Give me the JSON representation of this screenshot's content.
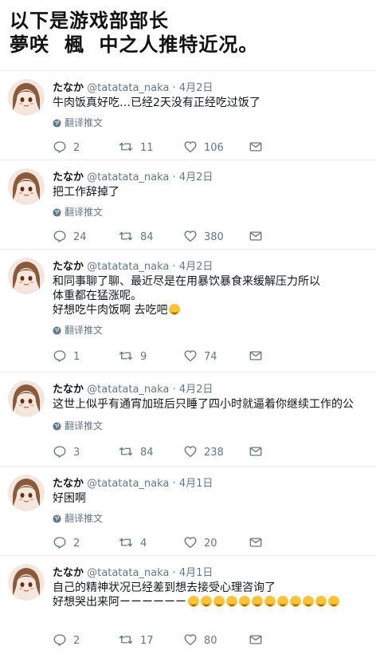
{
  "header": {
    "line1": "以下是游戏部部长",
    "line2": "夢咲  楓  中之人推特近况。"
  },
  "colors": {
    "muted": "#657786",
    "text": "#14171a",
    "border": "#e6ecf0"
  },
  "icons": {
    "reply": "reply-icon",
    "retweet": "retweet-icon",
    "like": "heart-icon",
    "dm": "mail-icon",
    "translate": "globe-icon"
  },
  "tweets": [
    {
      "name": "たなか",
      "handle": "@tatatata_naka",
      "sep": "·",
      "date": "4月2日",
      "lines": [
        "牛肉饭真好吃…已经2天没有正经吃过饭了"
      ],
      "translate": "翻译推文",
      "replies": "2",
      "retweets": "11",
      "likes": "106"
    },
    {
      "name": "たなか",
      "handle": "@tatatata_naka",
      "sep": "·",
      "date": "4月2日",
      "lines": [
        "把工作辞掉了"
      ],
      "translate": "翻译推文",
      "replies": "24",
      "retweets": "84",
      "likes": "380"
    },
    {
      "name": "たなか",
      "handle": "@tatatata_naka",
      "sep": "·",
      "date": "4月2日",
      "lines": [
        "和同事聊了聊、最近尽是在用暴饮暴食来缓解压力所以",
        "体重都在猛涨呢。",
        "好想吃牛肉饭啊  去吃吧"
      ],
      "translate": "翻译推文",
      "replies": "1",
      "retweets": "9",
      "likes": "74"
    },
    {
      "name": "たなか",
      "handle": "@tatatata_naka",
      "sep": "·",
      "date": "4月2日",
      "lines": [
        "这世上似乎有通宵加班后只睡了四小时就逼着你继续工作的公"
      ],
      "translate": "翻译推文",
      "replies": "3",
      "retweets": "84",
      "likes": "238"
    },
    {
      "name": "たなか",
      "handle": "@tatatata_naka",
      "sep": "·",
      "date": "4月1日",
      "lines": [
        "好困啊"
      ],
      "translate": "翻译推文",
      "replies": "2",
      "retweets": "4",
      "likes": "20"
    },
    {
      "name": "たなか",
      "handle": "@tatatata_naka",
      "sep": "·",
      "date": "4月1日",
      "lines": [
        "自己的精神状况已经差到想去接受心理咨询了",
        "好想哭出来阿ーーーーーー"
      ],
      "translate": "",
      "replies": "2",
      "retweets": "17",
      "likes": "80"
    }
  ]
}
